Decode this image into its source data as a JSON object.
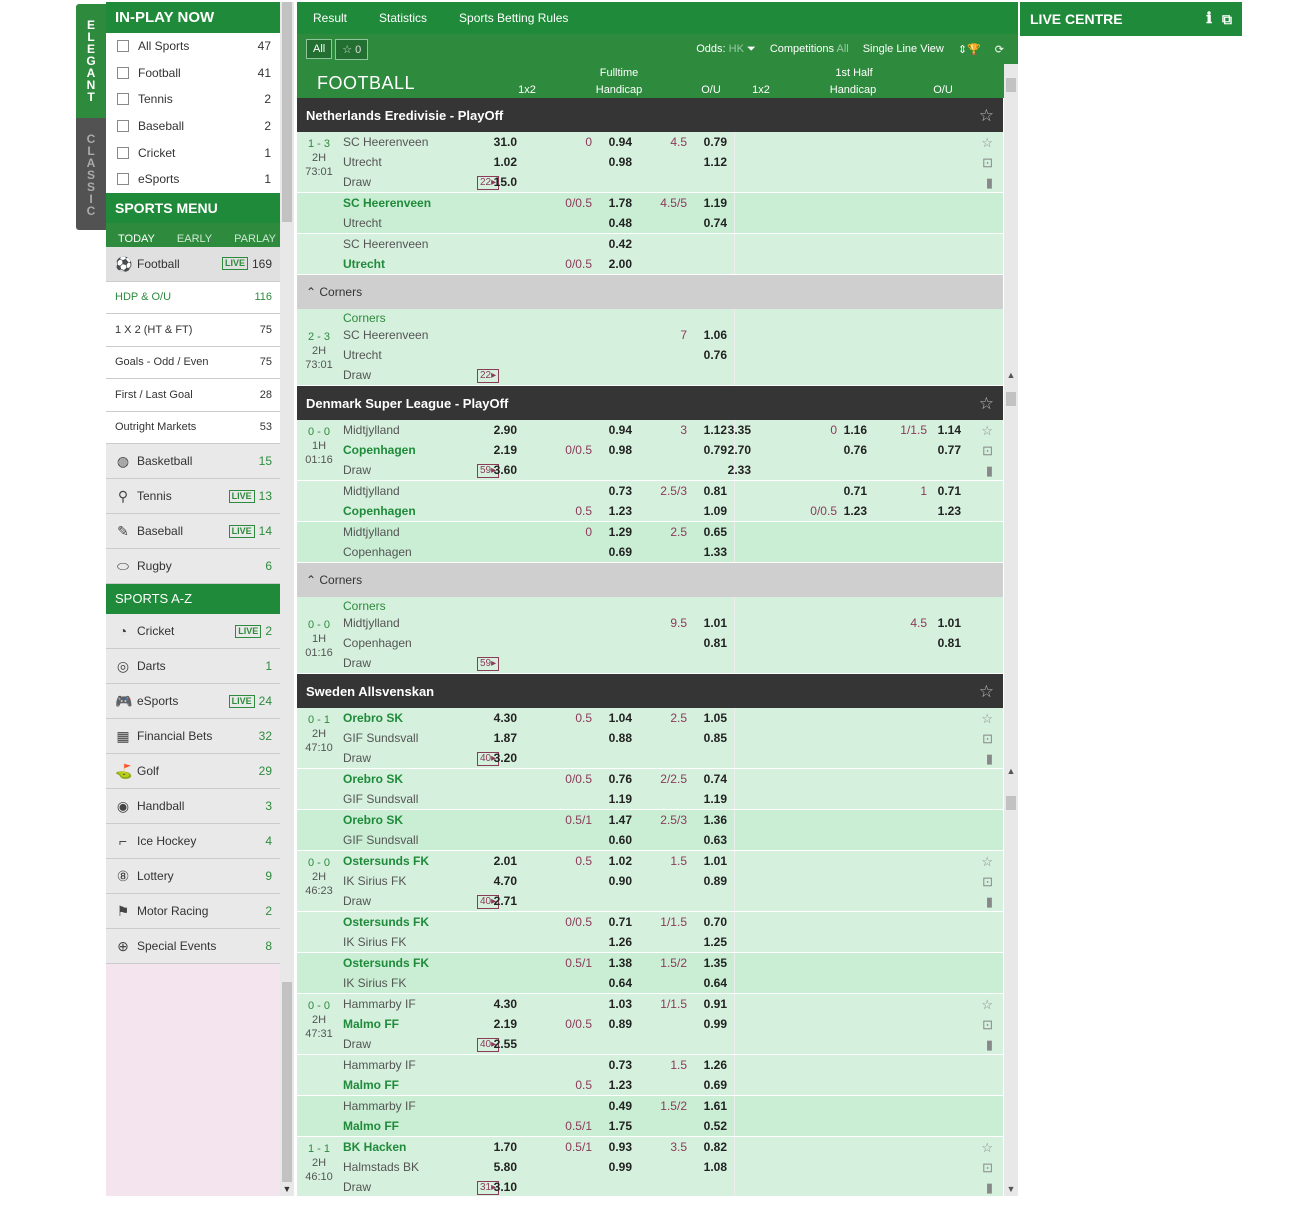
{
  "vtabs": {
    "elegant": "ELEGANT",
    "classic": "CLASSIC"
  },
  "inplay": {
    "title": "IN-PLAY NOW",
    "items": [
      {
        "name": "All Sports",
        "count": "47"
      },
      {
        "name": "Football",
        "count": "41"
      },
      {
        "name": "Tennis",
        "count": "2"
      },
      {
        "name": "Baseball",
        "count": "2"
      },
      {
        "name": "Cricket",
        "count": "1"
      },
      {
        "name": "eSports",
        "count": "1"
      }
    ]
  },
  "menu": {
    "title": "SPORTS MENU",
    "tabs": [
      "TODAY",
      "EARLY",
      "PARLAY"
    ],
    "football": {
      "name": "Football",
      "live": "LIVE",
      "count": "169"
    },
    "subs": [
      {
        "name": "HDP & O/U",
        "count": "116"
      },
      {
        "name": "1 X 2 (HT & FT)",
        "count": "75"
      },
      {
        "name": "Goals - Odd / Even",
        "count": "75"
      },
      {
        "name": "First / Last Goal",
        "count": "28"
      },
      {
        "name": "Outright Markets",
        "count": "53"
      }
    ],
    "sports": [
      {
        "name": "Basketball",
        "count": "15",
        "live": ""
      },
      {
        "name": "Tennis",
        "count": "13",
        "live": "LIVE"
      },
      {
        "name": "Baseball",
        "count": "14",
        "live": "LIVE"
      },
      {
        "name": "Rugby",
        "count": "6",
        "live": ""
      }
    ],
    "az_title": "SPORTS A-Z",
    "az": [
      {
        "name": "Cricket",
        "count": "2",
        "live": "LIVE"
      },
      {
        "name": "Darts",
        "count": "1",
        "live": ""
      },
      {
        "name": "eSports",
        "count": "24",
        "live": "LIVE"
      },
      {
        "name": "Financial Bets",
        "count": "32",
        "live": ""
      },
      {
        "name": "Golf",
        "count": "29",
        "live": ""
      },
      {
        "name": "Handball",
        "count": "3",
        "live": ""
      },
      {
        "name": "Ice Hockey",
        "count": "4",
        "live": ""
      },
      {
        "name": "Lottery",
        "count": "9",
        "live": ""
      },
      {
        "name": "Motor Racing",
        "count": "2",
        "live": ""
      },
      {
        "name": "Special Events",
        "count": "8",
        "live": ""
      }
    ]
  },
  "topnav": [
    "Result",
    "Statistics",
    "Sports Betting Rules"
  ],
  "filter": {
    "all": "All",
    "fav": "☆ 0",
    "odds": "Odds:",
    "odds_val": "HK",
    "comp": "Competitions",
    "comp_val": "All",
    "single": "Single Line View"
  },
  "header": {
    "title": "FOOTBALL",
    "ft": "Fulltime",
    "fh": "1st Half",
    "c1": "1x2",
    "c2": "Handicap",
    "c3": "O/U",
    "c4": "1x2",
    "c5": "Handicap",
    "c6": "O/U"
  },
  "corners_label": "Corners",
  "live_centre": "LIVE CENTRE",
  "blocks": [
    {
      "type": "league",
      "name": "Netherlands Eredivisie - PlayOff"
    },
    {
      "type": "match",
      "score": "1 - 3",
      "half": "2H",
      "time": "73:01",
      "badge": "22",
      "icons": true,
      "lines": [
        {
          "t": "SC Heerenveen",
          "b": false,
          "x": "31.0",
          "h": "0",
          "hv": "0.94",
          "o": "4.5",
          "ov": "0.79"
        },
        {
          "t": "Utrecht",
          "b": false,
          "x": "1.02",
          "h": "",
          "hv": "0.98",
          "o": "",
          "ov": "1.12"
        },
        {
          "t": "Draw",
          "b": false,
          "x": "15.0"
        }
      ]
    },
    {
      "type": "sub",
      "alt": true,
      "lines": [
        {
          "t": "SC Heerenveen",
          "b": true,
          "h": "0/0.5",
          "hv": "1.78",
          "o": "4.5/5",
          "ov": "1.19"
        },
        {
          "t": "Utrecht",
          "b": false,
          "hv": "0.48",
          "ov": "0.74"
        }
      ]
    },
    {
      "type": "sub",
      "alt": false,
      "lines": [
        {
          "t": "SC Heerenveen",
          "b": false,
          "hv": "0.42"
        },
        {
          "t": "Utrecht",
          "b": true,
          "h": "0/0.5",
          "hv": "2.00"
        }
      ]
    },
    {
      "type": "corners"
    },
    {
      "type": "match",
      "cornerlbl": "Corners",
      "score": "2 - 3",
      "half": "2H",
      "time": "73:01",
      "badge": "22",
      "icons": false,
      "lines": [
        {
          "t": "SC Heerenveen",
          "b": false,
          "o": "7",
          "ov": "1.06"
        },
        {
          "t": "Utrecht",
          "b": false,
          "ov": "0.76"
        },
        {
          "t": "Draw",
          "b": false
        }
      ]
    },
    {
      "type": "league",
      "name": "Denmark Super League - PlayOff"
    },
    {
      "type": "match",
      "score": "0 - 0",
      "half": "1H",
      "time": "01:16",
      "badge": "59",
      "icons": true,
      "lines": [
        {
          "t": "Midtjylland",
          "b": false,
          "x": "2.90",
          "hv": "0.94",
          "o": "3",
          "ov": "1.12",
          "x2": "3.35",
          "h2": "0",
          "hv2": "1.16",
          "o2": "1/1.5",
          "ov2": "1.14"
        },
        {
          "t": "Copenhagen",
          "b": true,
          "x": "2.19",
          "h": "0/0.5",
          "hv": "0.98",
          "ov": "0.79",
          "x2": "2.70",
          "hv2": "0.76",
          "ov2": "0.77"
        },
        {
          "t": "Draw",
          "b": false,
          "x": "3.60",
          "x2": "2.33"
        }
      ]
    },
    {
      "type": "sub",
      "alt": false,
      "lines": [
        {
          "t": "Midtjylland",
          "b": false,
          "hv": "0.73",
          "o": "2.5/3",
          "ov": "0.81",
          "hv2": "0.71",
          "o2": "1",
          "ov2": "0.71"
        },
        {
          "t": "Copenhagen",
          "b": true,
          "h": "0.5",
          "hv": "1.23",
          "ov": "1.09",
          "h2": "0/0.5",
          "hv2": "1.23",
          "ov2": "1.23"
        }
      ]
    },
    {
      "type": "sub",
      "alt": true,
      "lines": [
        {
          "t": "Midtjylland",
          "b": false,
          "h": "0",
          "hv": "1.29",
          "o": "2.5",
          "ov": "0.65"
        },
        {
          "t": "Copenhagen",
          "b": false,
          "hv": "0.69",
          "ov": "1.33"
        }
      ]
    },
    {
      "type": "corners"
    },
    {
      "type": "match",
      "cornerlbl": "Corners",
      "score": "0 - 0",
      "half": "1H",
      "time": "01:16",
      "badge": "59",
      "icons": false,
      "lines": [
        {
          "t": "Midtjylland",
          "b": false,
          "o": "9.5",
          "ov": "1.01",
          "o2": "4.5",
          "ov2": "1.01"
        },
        {
          "t": "Copenhagen",
          "b": false,
          "ov": "0.81",
          "ov2": "0.81"
        },
        {
          "t": "Draw",
          "b": false
        }
      ]
    },
    {
      "type": "league",
      "name": "Sweden Allsvenskan"
    },
    {
      "type": "match",
      "score": "0 - 1",
      "half": "2H",
      "time": "47:10",
      "badge": "40",
      "icons": true,
      "lines": [
        {
          "t": "Orebro SK",
          "b": true,
          "x": "4.30",
          "h": "0.5",
          "hv": "1.04",
          "o": "2.5",
          "ov": "1.05"
        },
        {
          "t": "GIF Sundsvall",
          "b": false,
          "x": "1.87",
          "hv": "0.88",
          "ov": "0.85"
        },
        {
          "t": "Draw",
          "b": false,
          "x": "3.20"
        }
      ]
    },
    {
      "type": "sub",
      "alt": false,
      "lines": [
        {
          "t": "Orebro SK",
          "b": true,
          "h": "0/0.5",
          "hv": "0.76",
          "o": "2/2.5",
          "ov": "0.74"
        },
        {
          "t": "GIF Sundsvall",
          "b": false,
          "hv": "1.19",
          "ov": "1.19"
        }
      ]
    },
    {
      "type": "sub",
      "alt": true,
      "lines": [
        {
          "t": "Orebro SK",
          "b": true,
          "h": "0.5/1",
          "hv": "1.47",
          "o": "2.5/3",
          "ov": "1.36"
        },
        {
          "t": "GIF Sundsvall",
          "b": false,
          "hv": "0.60",
          "ov": "0.63"
        }
      ]
    },
    {
      "type": "match",
      "score": "0 - 0",
      "half": "2H",
      "time": "46:23",
      "badge": "40",
      "icons": true,
      "lines": [
        {
          "t": "Ostersunds FK",
          "b": true,
          "x": "2.01",
          "h": "0.5",
          "hv": "1.02",
          "o": "1.5",
          "ov": "1.01"
        },
        {
          "t": "IK Sirius FK",
          "b": false,
          "x": "4.70",
          "hv": "0.90",
          "ov": "0.89"
        },
        {
          "t": "Draw",
          "b": false,
          "x": "2.71"
        }
      ]
    },
    {
      "type": "sub",
      "alt": false,
      "lines": [
        {
          "t": "Ostersunds FK",
          "b": true,
          "h": "0/0.5",
          "hv": "0.71",
          "o": "1/1.5",
          "ov": "0.70"
        },
        {
          "t": "IK Sirius FK",
          "b": false,
          "hv": "1.26",
          "ov": "1.25"
        }
      ]
    },
    {
      "type": "sub",
      "alt": true,
      "lines": [
        {
          "t": "Ostersunds FK",
          "b": true,
          "h": "0.5/1",
          "hv": "1.38",
          "o": "1.5/2",
          "ov": "1.35"
        },
        {
          "t": "IK Sirius FK",
          "b": false,
          "hv": "0.64",
          "ov": "0.64"
        }
      ]
    },
    {
      "type": "match",
      "score": "0 - 0",
      "half": "2H",
      "time": "47:31",
      "badge": "40",
      "icons": true,
      "lines": [
        {
          "t": "Hammarby IF",
          "b": false,
          "x": "4.30",
          "hv": "1.03",
          "o": "1/1.5",
          "ov": "0.91"
        },
        {
          "t": "Malmo FF",
          "b": true,
          "x": "2.19",
          "h": "0/0.5",
          "hv": "0.89",
          "ov": "0.99"
        },
        {
          "t": "Draw",
          "b": false,
          "x": "2.55"
        }
      ]
    },
    {
      "type": "sub",
      "alt": false,
      "lines": [
        {
          "t": "Hammarby IF",
          "b": false,
          "hv": "0.73",
          "o": "1.5",
          "ov": "1.26"
        },
        {
          "t": "Malmo FF",
          "b": true,
          "h": "0.5",
          "hv": "1.23",
          "ov": "0.69"
        }
      ]
    },
    {
      "type": "sub",
      "alt": true,
      "lines": [
        {
          "t": "Hammarby IF",
          "b": false,
          "hv": "0.49",
          "o": "1.5/2",
          "ov": "1.61"
        },
        {
          "t": "Malmo FF",
          "b": true,
          "h": "0.5/1",
          "hv": "1.75",
          "ov": "0.52"
        }
      ]
    },
    {
      "type": "match",
      "score": "1 - 1",
      "half": "2H",
      "time": "46:10",
      "badge": "31",
      "icons": true,
      "lines": [
        {
          "t": "BK Hacken",
          "b": true,
          "x": "1.70",
          "h": "0.5/1",
          "hv": "0.93",
          "o": "3.5",
          "ov": "0.82"
        },
        {
          "t": "Halmstads BK",
          "b": false,
          "x": "5.80",
          "hv": "0.99",
          "ov": "1.08"
        },
        {
          "t": "Draw",
          "b": false,
          "x": "3.10"
        }
      ]
    }
  ]
}
